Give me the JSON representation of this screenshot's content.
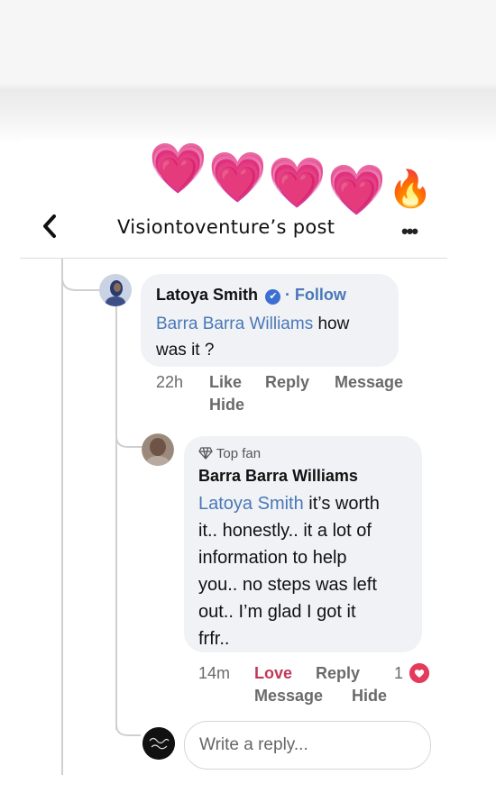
{
  "header": {
    "title": "Visiontoventure’s post",
    "back_icon": "‹",
    "more_icon": "•••"
  },
  "stickers": [
    "💗",
    "💗",
    "💗",
    "💗",
    "🔥"
  ],
  "comment1": {
    "author": "Latoya Smith",
    "verified_icon": "✔",
    "follow": "· Follow",
    "mention": "Barra Barra Williams",
    "text_line1_suffix": " how",
    "text_line2": "was it ?",
    "time": "22h",
    "like": "Like",
    "reply": "Reply",
    "message": "Message",
    "hide": "Hide"
  },
  "comment2": {
    "badge": "Top fan",
    "author": "Barra Barra Williams",
    "mention": "Latoya Smith",
    "line1_suffix": " it’s worth",
    "line2": "it.. honestly.. it a lot of",
    "line3": "information to help",
    "line4": "you.. no steps was left",
    "line5": "out.. I’m glad I got it",
    "line6": "frfr..",
    "time": "14m",
    "love": "Love",
    "reply": "Reply",
    "reaction_count": "1",
    "message": "Message",
    "hide": "Hide"
  },
  "reply_box": {
    "placeholder": "Write a reply..."
  },
  "colors": {
    "link_blue": "#4a78b8",
    "love_red": "#c0395a",
    "bubble_bg": "#f0f2f5"
  }
}
